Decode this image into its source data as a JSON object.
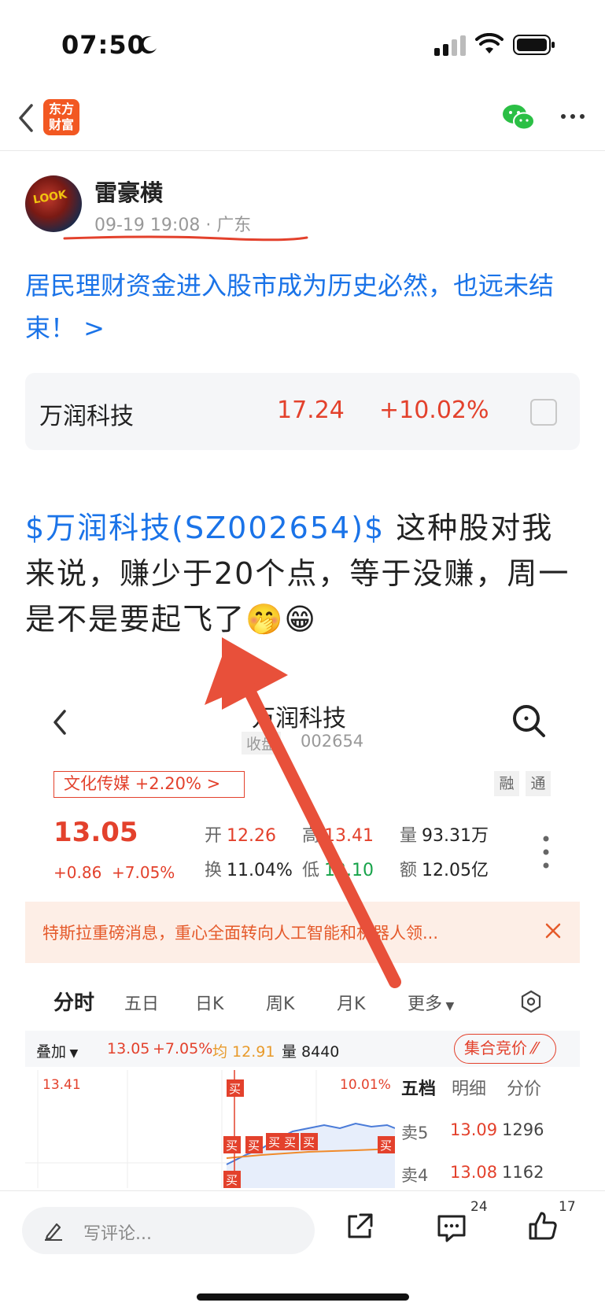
{
  "status": {
    "time": "07:50"
  },
  "nav": {
    "logo_line1": "东方",
    "logo_line2": "财富"
  },
  "author": {
    "avatar_text": "LOOK",
    "name": "雷豪横",
    "meta": "09-19 19:08 · 广东"
  },
  "headline": "居民理财资金进入股市成为历史必然，也远未结束！ >",
  "stock_card": {
    "name": "万润科技",
    "price": "17.24",
    "change": "+10.02%"
  },
  "post": {
    "tag": "$万润科技(SZ002654)$",
    "text": " 这种股对我来说，赚少于20个点，等于没赚，周一是不是要起飞了",
    "emoji": "🤭😁"
  },
  "embed": {
    "title": "万润科技",
    "sub_tag": "收盘",
    "code": "002654",
    "sector": "文化传媒 +2.20% >",
    "tag_rong": "融",
    "tag_tong": "通",
    "price": "13.05",
    "change": "+0.86",
    "pct": "+7.05%",
    "fields": {
      "open_label": "开",
      "open": "12.26",
      "high_label": "高",
      "high": "13.41",
      "vol_label": "量",
      "vol": "93.31万",
      "turn_label": "换",
      "turn": "11.04%",
      "low_label": "低",
      "low": "12.10",
      "amt_label": "额",
      "amt": "12.05亿"
    },
    "notice": "特斯拉重磅消息，重心全面转向人工智能和机器人领...",
    "tabs": [
      "分时",
      "五日",
      "日K",
      "周K",
      "月K",
      "更多"
    ],
    "overlay": {
      "label": "叠加",
      "price": "13.05",
      "pct": "+7.05%",
      "avg": "均 12.91",
      "vol": "量 8440",
      "auction": "集合竞价"
    },
    "chart": {
      "high_label": "13.41",
      "pct_label": "10.01%",
      "sell_marker": "买"
    },
    "orderbook": {
      "headers": [
        "五档",
        "明细",
        "分价"
      ],
      "rows": [
        {
          "label": "卖5",
          "price": "13.09",
          "qty": "1296"
        },
        {
          "label": "卖4",
          "price": "13.08",
          "qty": "1162"
        }
      ]
    }
  },
  "bottom": {
    "placeholder": "写评论...",
    "comments": "24",
    "likes": "17"
  }
}
